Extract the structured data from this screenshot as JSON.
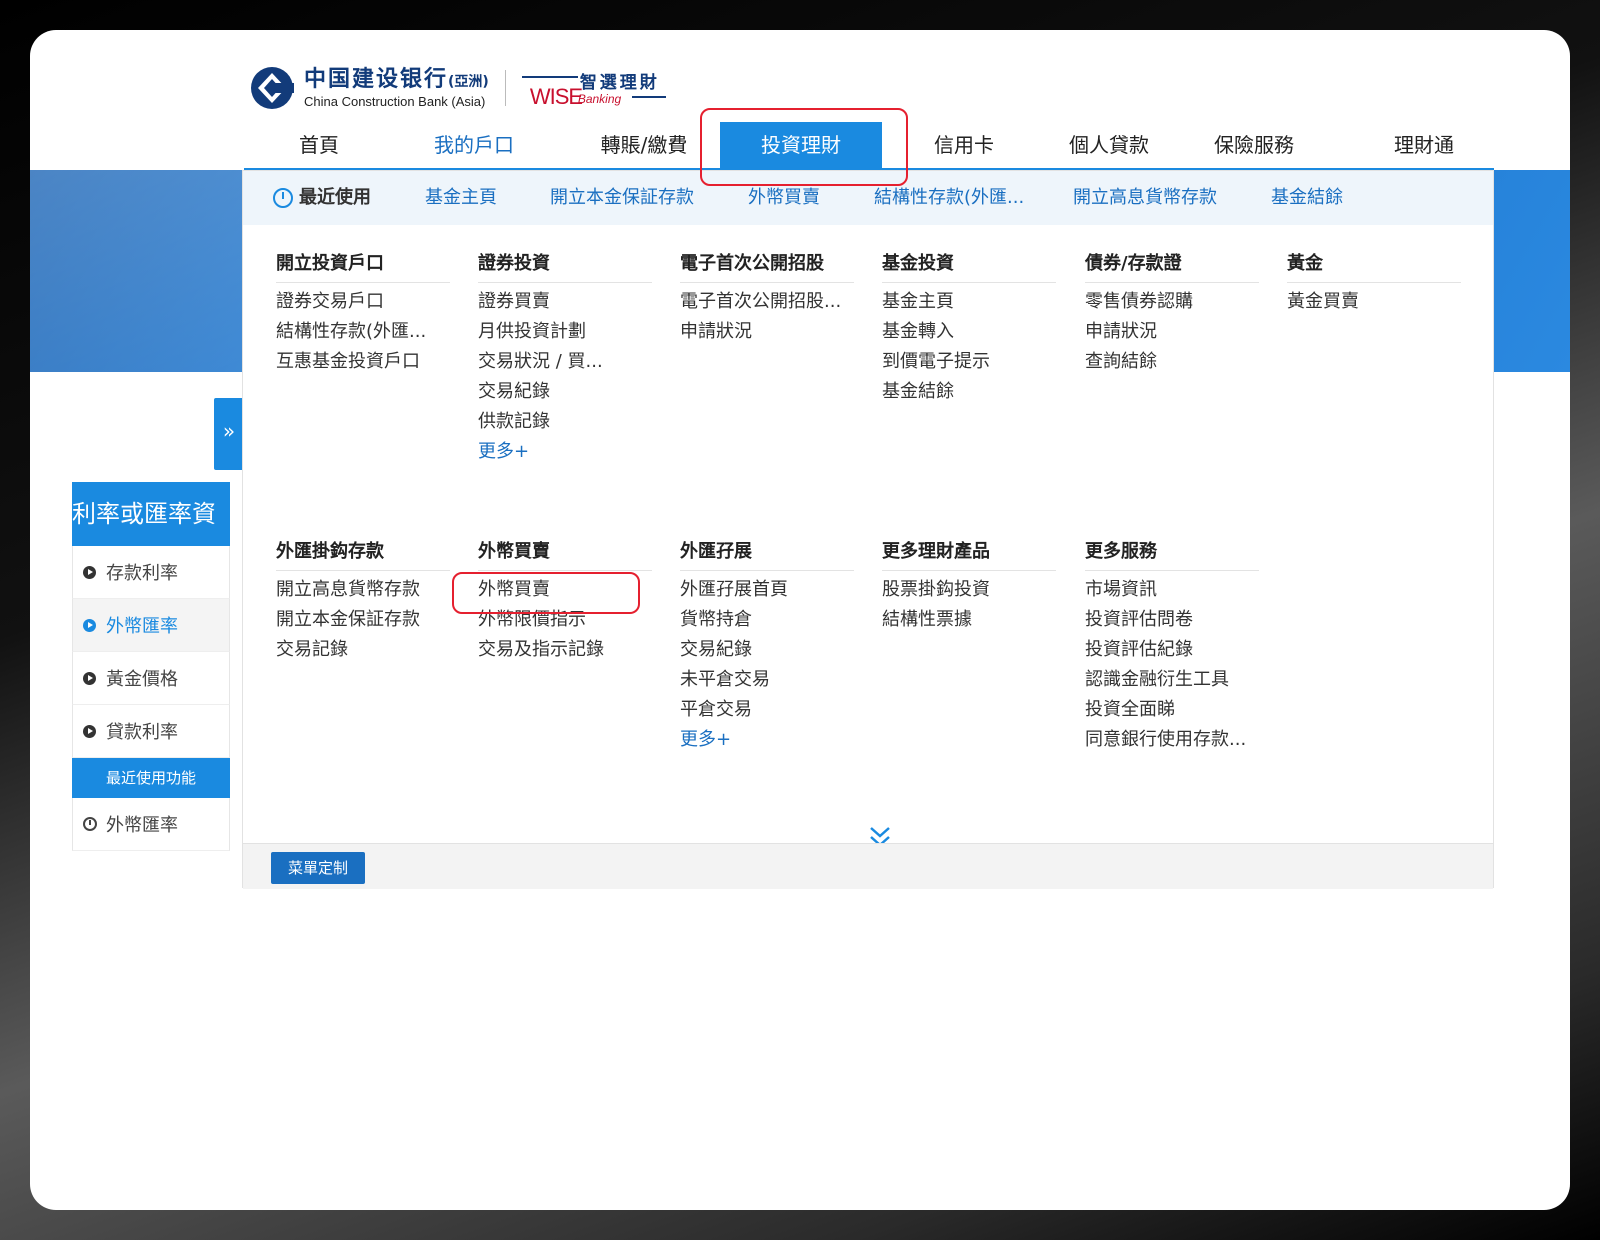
{
  "brand": {
    "name_cn": "中国建设银行",
    "name_suffix": "(亞洲)",
    "name_en": "China Construction Bank (Asia)",
    "wise_cn": "智選理財",
    "wise_word": "WISE",
    "wise_sub": "Banking"
  },
  "nav": {
    "items": [
      {
        "label": "首頁"
      },
      {
        "label": "我的戶口"
      },
      {
        "label": "轉賬/繳費"
      },
      {
        "label": "投資理財"
      },
      {
        "label": "信用卡"
      },
      {
        "label": "個人貸款"
      },
      {
        "label": "保險服務"
      },
      {
        "label": "理財通"
      }
    ],
    "active": "投資理財"
  },
  "recent": {
    "title": "最近使用",
    "links": [
      "基金主頁",
      "開立本金保証存款",
      "外幣買賣",
      "結構性存款(外匯...",
      "開立高息貨幣存款",
      "基金結餘"
    ]
  },
  "menu": {
    "row1": [
      {
        "title": "開立投資戶口",
        "links": [
          "證券交易戶口",
          "結構性存款(外匯...",
          "互惠基金投資戶口"
        ]
      },
      {
        "title": "證券投資",
        "links": [
          "證券買賣",
          "月供投資計劃",
          "交易狀況 / 買...",
          "交易紀錄",
          "供款記錄"
        ],
        "more": "更多+"
      },
      {
        "title": "電子首次公開招股",
        "links": [
          "電子首次公開招股...",
          "申請狀況"
        ]
      },
      {
        "title": "基金投資",
        "links": [
          "基金主頁",
          "基金轉入",
          "到價電子提示",
          "基金結餘"
        ]
      },
      {
        "title": "債券/存款證",
        "links": [
          "零售債券認購",
          "申請狀況",
          "查詢結餘"
        ]
      },
      {
        "title": "黃金",
        "links": [
          "黃金買賣"
        ]
      }
    ],
    "row2": [
      {
        "title": "外匯掛鈎存款",
        "links": [
          "開立高息貨幣存款",
          "開立本金保証存款",
          "交易記錄"
        ]
      },
      {
        "title": "外幣買賣",
        "links": [
          "外幣買賣",
          "外幣限價指示",
          "交易及指示記錄"
        ]
      },
      {
        "title": "外匯孖展",
        "links": [
          "外匯孖展首頁",
          "貨幣持倉",
          "交易紀錄",
          "未平倉交易",
          "平倉交易"
        ],
        "more": "更多+"
      },
      {
        "title": "更多理財產品",
        "links": [
          "股票掛鈎投資",
          "結構性票據"
        ]
      },
      {
        "title": "更多服務",
        "links": [
          "市場資訊",
          "投資評估問卷",
          "投資評估紀錄",
          "認識金融衍生工具",
          "投資全面睇",
          "同意銀行使用存款..."
        ]
      }
    ]
  },
  "footer": {
    "custom_button": "菜單定制"
  },
  "sidebar": {
    "header": "利率或匯率資",
    "items": [
      {
        "label": "存款利率"
      },
      {
        "label": "外幣匯率"
      },
      {
        "label": "黃金價格"
      },
      {
        "label": "貸款利率"
      }
    ],
    "active": "外幣匯率",
    "recent_title": "最近使用功能",
    "recent_item": "外幣匯率"
  },
  "expand_tab": "»",
  "colors": {
    "accent": "#1a8ae0",
    "link": "#1a6fc1",
    "highlight": "#e5202f"
  }
}
